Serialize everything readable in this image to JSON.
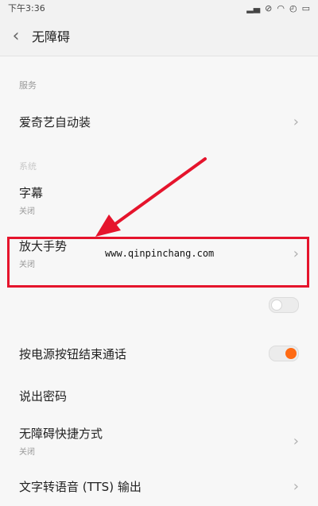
{
  "status": {
    "time": "下午3:36",
    "icons": [
      "signal-icon",
      "mute-icon",
      "wifi-icon",
      "alarm-icon",
      "battery-icon"
    ]
  },
  "header": {
    "back_glyph": "‹",
    "title": "无障碍"
  },
  "sections": {
    "services": "服务",
    "system": "系统"
  },
  "items": {
    "iqiyi": {
      "label": "爱奇艺自动装"
    },
    "subtitle": {
      "label": "字幕",
      "sub": "关闭"
    },
    "magnify": {
      "label": "放大手势",
      "sub": "关闭"
    },
    "power_end_call": {
      "label": "按电源按钮结束通话"
    },
    "speak_password": {
      "label": "说出密码"
    },
    "shortcut": {
      "label": "无障碍快捷方式",
      "sub": "关闭"
    },
    "tts": {
      "label": "文字转语音 (TTS) 输出"
    }
  },
  "watermark": "www.qinpinchang.com",
  "colors": {
    "accent": "#ff6a13",
    "highlight": "#e5142c",
    "arrow": "#e5142c"
  }
}
